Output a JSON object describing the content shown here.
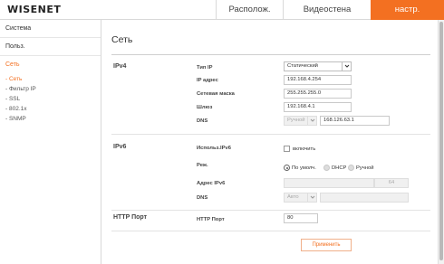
{
  "header": {
    "logo": "WISENET",
    "tabs": [
      {
        "label": "Располож."
      },
      {
        "label": "Видеостена"
      },
      {
        "label": "настр."
      }
    ]
  },
  "sidebar": {
    "categories": [
      {
        "label": "Система"
      },
      {
        "label": "Польз."
      },
      {
        "label": "Сеть"
      }
    ],
    "items": [
      {
        "label": "- Сеть"
      },
      {
        "label": "- Фильтр IP"
      },
      {
        "label": "- SSL"
      },
      {
        "label": "- 802.1x"
      },
      {
        "label": "- SNMP"
      }
    ]
  },
  "main": {
    "title": "Сеть",
    "ipv4": {
      "section": "IPv4",
      "ip_type_label": "Тип IP",
      "ip_type_value": "Статический",
      "ip_label": "IP адрес",
      "ip_value": "192.168.4.254",
      "mask_label": "Сетевая маска",
      "mask_value": "255.255.255.0",
      "gateway_label": "Шлюз",
      "gateway_value": "192.168.4.1",
      "dns_label": "DNS",
      "dns_mode": "Ручной",
      "dns_value": "168.126.63.1"
    },
    "ipv6": {
      "section": "IPv6",
      "use_label": "Использ.IPv6",
      "enable_label": "включить",
      "mode_label": "Реж.",
      "modes": [
        {
          "label": "По умолч.",
          "selected": true
        },
        {
          "label": "DHCP",
          "selected": false
        },
        {
          "label": "Ручной",
          "selected": false
        }
      ],
      "address_label": "Адрес IPv6",
      "prefix": "64",
      "dns_label": "DNS",
      "dns_mode": "Авто"
    },
    "http": {
      "section": "HTTP Порт",
      "port_label": "HTTP Порт",
      "port_value": "80"
    },
    "apply_label": "Применить"
  },
  "colors": {
    "accent": "#f37021",
    "border": "#c9c9c9",
    "disabled": "#f0f0f0"
  }
}
